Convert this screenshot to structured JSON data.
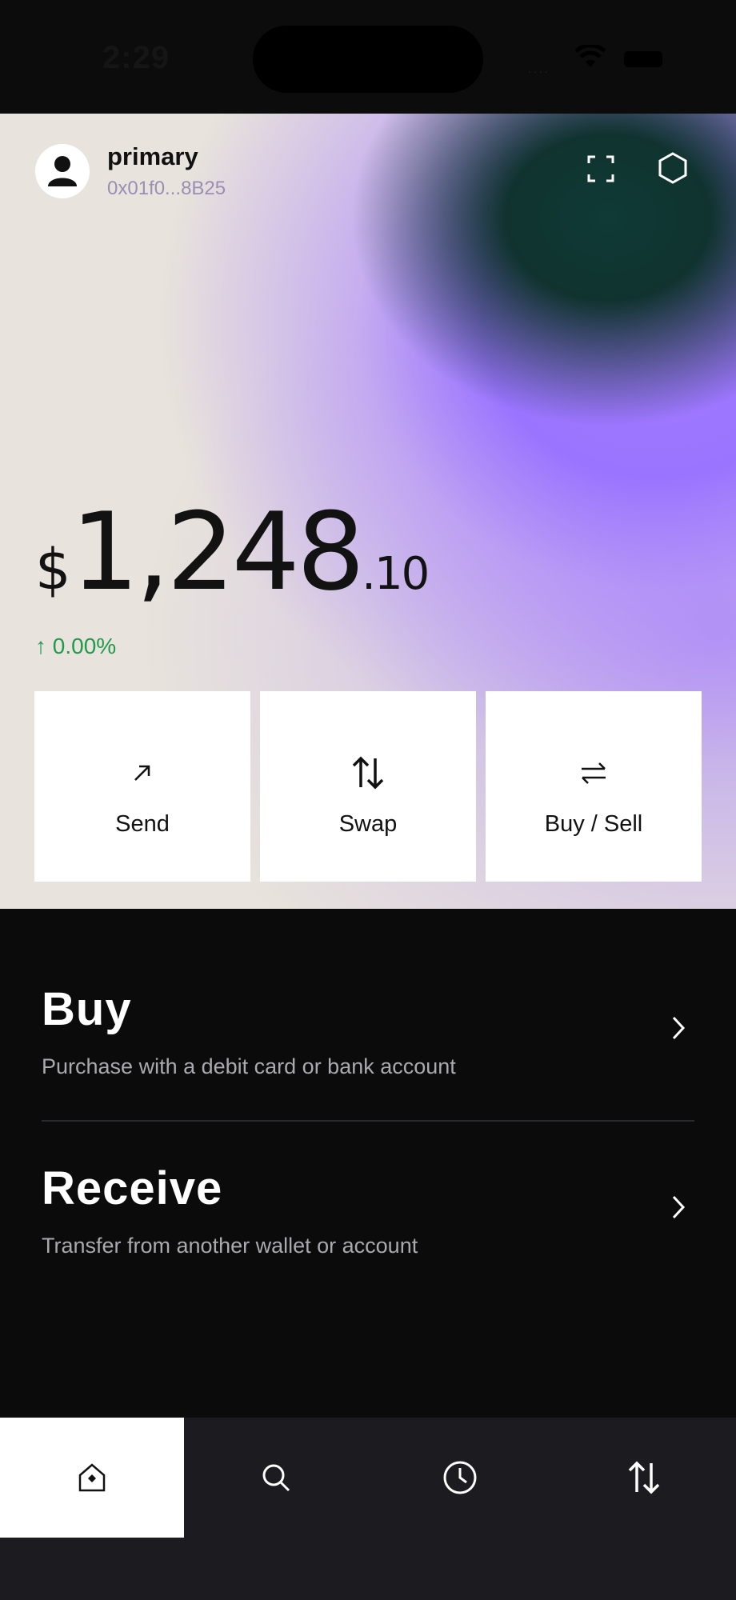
{
  "status_bar": {
    "time": "2:29"
  },
  "account": {
    "name": "primary",
    "address": "0x01f0...8B25"
  },
  "balance": {
    "currency": "$",
    "whole": "1,248",
    "decimal": ".10",
    "change": "0.00%"
  },
  "actions": [
    {
      "label": "Send",
      "icon": "arrow-up-right-icon"
    },
    {
      "label": "Swap",
      "icon": "swap-vertical-icon"
    },
    {
      "label": "Buy / Sell",
      "icon": "arrows-left-right-icon"
    }
  ],
  "list": [
    {
      "title": "Buy",
      "subtitle": "Purchase with a debit card or bank account"
    },
    {
      "title": "Receive",
      "subtitle": "Transfer from another wallet or account"
    }
  ],
  "tabs": [
    {
      "icon": "home-icon",
      "active": true
    },
    {
      "icon": "search-icon",
      "active": false
    },
    {
      "icon": "clock-icon",
      "active": false
    },
    {
      "icon": "transfer-icon",
      "active": false
    }
  ],
  "colors": {
    "accent_purple": "#a47bff",
    "positive": "#1f9a4a",
    "background": "#0b0b0c",
    "tabbar": "#1b1b20"
  }
}
